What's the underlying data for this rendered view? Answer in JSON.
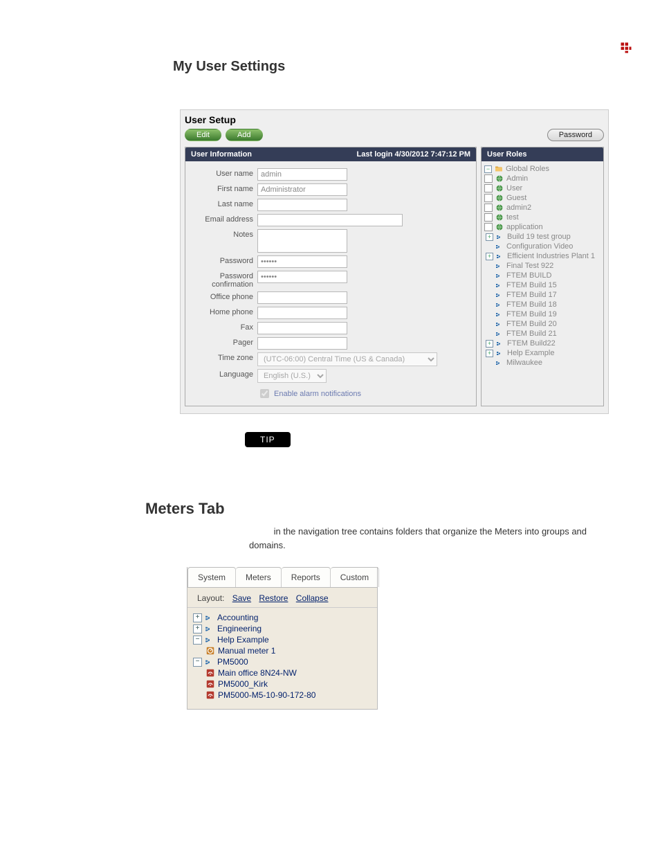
{
  "header": {
    "brand_icon": "logo-icon"
  },
  "sections": {
    "my_user_settings_title": "My User Settings",
    "meters_tab_title": "Meters Tab"
  },
  "user_setup": {
    "title": "User Setup",
    "buttons": {
      "edit": "Edit",
      "add": "Add",
      "password": "Password"
    },
    "info_header": "User Information",
    "last_login_label": "Last login 4/30/2012 7:47:12 PM",
    "fields": {
      "user_name_label": "User name",
      "user_name_value": "admin",
      "first_name_label": "First name",
      "first_name_value": "Administrator",
      "last_name_label": "Last name",
      "last_name_value": "",
      "email_label": "Email address",
      "email_value": "",
      "notes_label": "Notes",
      "notes_value": "",
      "password_label": "Password",
      "password_value": "******",
      "password_conf_label": "Password confirmation",
      "password_conf_value": "******",
      "office_label": "Office phone",
      "office_value": "",
      "home_label": "Home phone",
      "home_value": "",
      "fax_label": "Fax",
      "fax_value": "",
      "pager_label": "Pager",
      "pager_value": "",
      "tz_label": "Time zone",
      "tz_value": "(UTC-06:00) Central Time (US & Canada)",
      "lang_label": "Language",
      "lang_value": "English (U.S.)",
      "alarm_label": "Enable alarm notifications"
    },
    "roles_header": "User Roles",
    "roles": {
      "global": "Global Roles",
      "items": [
        "Admin",
        "User",
        "Guest",
        "admin2",
        "test",
        "application"
      ],
      "groups": [
        "Build 19 test group",
        "Configuration Video",
        "Efficient Industries Plant 1",
        "Final Test 922",
        "FTEM BUILD",
        "FTEM Build 15",
        "FTEM Build 17",
        "FTEM Build 18",
        "FTEM Build 19",
        "FTEM Build 20",
        "FTEM Build 21",
        "FTEM Build22",
        "Help Example",
        "Milwaukee"
      ]
    }
  },
  "tip": {
    "label": "TIP"
  },
  "meters_text_tail": " in the navigation tree contains folders that organize the Meters into groups and domains.",
  "meters_panel": {
    "tabs": [
      "System",
      "Meters",
      "Reports",
      "Custom"
    ],
    "layout_label": "Layout:",
    "layout_links": [
      "Save",
      "Restore",
      "Collapse"
    ],
    "nodes": {
      "accounting": "Accounting",
      "engineering": "Engineering",
      "help_example": "Help Example",
      "manual_meter": "Manual meter 1",
      "pm5000": "PM5000",
      "pm_children": [
        "Main office 8N24-NW",
        "PM5000_Kirk",
        "PM5000-M5-10-90-172-80"
      ]
    }
  }
}
